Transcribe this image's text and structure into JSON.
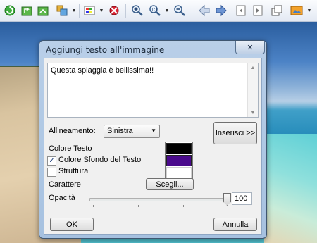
{
  "toolbar": {
    "icons": [
      "refresh-icon",
      "rotate-icon",
      "forward-icon",
      "batch-icon",
      "color-palette-icon",
      "red-eye-icon",
      "zoom-in-icon",
      "zoom-1to1-icon",
      "zoom-out-icon",
      "arrow-left-icon",
      "arrow-right-icon",
      "page-prev-icon",
      "page-next-icon",
      "copy-window-icon",
      "picture-icon"
    ]
  },
  "dialog": {
    "title": "Aggiungi testo all'immagine",
    "close_symbol": "✕",
    "text_value": "Questa spiaggia è bellissima!!",
    "alignment_label": "Allineamento:",
    "alignment_value": "Sinistra",
    "insert_button": "Inserisci >>",
    "text_color_label": "Colore Testo",
    "bg_color_label": "Colore Sfondo del Testo",
    "bg_color_checked": true,
    "outline_label": "Struttura",
    "outline_checked": false,
    "font_label": "Carattere",
    "choose_button": "Scegli...",
    "opacity_label": "Opacità",
    "opacity_value": "100",
    "ok_button": "OK",
    "cancel_button": "Annulla",
    "colors": {
      "text": "#000000",
      "background": "#4a0a8c",
      "outline": "#ffffff"
    }
  }
}
